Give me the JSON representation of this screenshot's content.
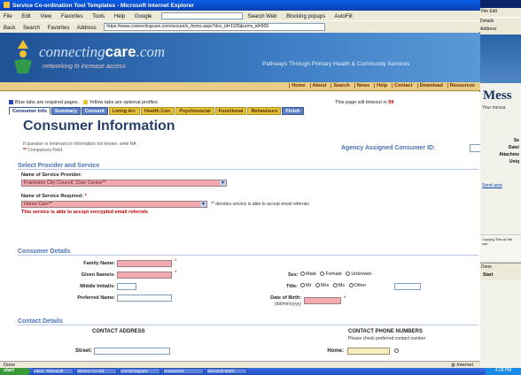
{
  "browser": {
    "title": "Service Co-ordination Tool Templates - Microsoft Internet Explorer",
    "menu": [
      "File",
      "Edit",
      "View",
      "Favorites",
      "Tools",
      "Help"
    ],
    "google_label": "Google",
    "toolbar": [
      "Back",
      "Search",
      "Favorites",
      "Address"
    ],
    "search_web": "Search Web",
    "popups": "Blocking popups",
    "autofill": "AutoFill",
    "address": "https://www.connectingcare.com/secure/s_forms.aspx?doc_id=1105&uri=s_id=509"
  },
  "back_window": {
    "menu": "File Edit",
    "toolbar": "Details",
    "address": "Address",
    "title": "Mess",
    "intro": "Your messa",
    "labels": [
      "Se",
      "Date/",
      "Attachme",
      "Uniq"
    ],
    "link": "Send anot",
    "footer": "Copyrig This sit We can",
    "status": "Done",
    "start": "Start"
  },
  "banner": {
    "logo_prefix": "connecting",
    "logo_bold": "care",
    "logo_suffix": ".com",
    "tagline": "networking to increase access",
    "slogan": "Pathways Through Primary Health & Community Services"
  },
  "nav": [
    "Home",
    "About",
    "Search",
    "News",
    "Help",
    "Contact",
    "Download",
    "Resources"
  ],
  "page": {
    "legend_blue": "Blue tabs are required pages.",
    "legend_yellow": "Yellow tabs are optional profiles",
    "timeout_text": "This page will timeout in",
    "timeout_value": "59",
    "tabs": [
      {
        "label": "Consumer Info",
        "type": "active"
      },
      {
        "label": "Summary",
        "type": "req"
      },
      {
        "label": "Consent",
        "type": "req"
      },
      {
        "label": "Living Arr.",
        "type": "opt"
      },
      {
        "label": "Health Con.",
        "type": "opt"
      },
      {
        "label": "Psychosocial",
        "type": "opt"
      },
      {
        "label": "Functional",
        "type": "opt"
      },
      {
        "label": "Behaviours",
        "type": "opt"
      },
      {
        "label": "Finish",
        "type": "req"
      }
    ],
    "heading": "Consumer Information",
    "note_unknown": "If question is irrelevant or information not known, write NA",
    "note_compulsory": "Compulsory Field",
    "agency_label": "Agency Assigned Consumer ID:",
    "section_provider": "Select Provider and Service",
    "provider_label": "Name of Service Provider:",
    "provider_value": "Frankston City Council, Civic Centre**",
    "service_label": "Name of Service Required:",
    "service_value": "Home Care**",
    "service_note": "** denotes service is able to accept email referrals",
    "encrypted_note": "This service is able to accept encrypted email referrals",
    "section_details": "Consumer Details",
    "family_name": "Family Name:",
    "given_names": "Given Name/s:",
    "middle_initial": "Middle Initial/s:",
    "preferred_name": "Preferred Name:",
    "sex_label": "Sex:",
    "sex_options": [
      "Male",
      "Female",
      "Unknown"
    ],
    "title_label": "Title:",
    "title_options": [
      "Mr",
      "Mrs",
      "Ms",
      "Other"
    ],
    "dob_label": "Date of Birth:",
    "dob_format": "(dd/mm/yyyy)",
    "section_contact": "Contact Details",
    "contact_address": "CONTACT ADDRESS",
    "street_label": "Street:",
    "phone_heading": "CONTACT PHONE NUMBERS",
    "phone_sub": "Please check preferred contact number",
    "home_label": "Home:"
  },
  "status": {
    "left": "Done",
    "zone": "Internet"
  },
  "taskbar": {
    "start": "start",
    "tasks": [
      "Inbox - Microsoft",
      "Service Co-ord",
      "connectingcare",
      "Documents",
      "Microsoft Word"
    ],
    "clock": "4:28 PM"
  }
}
